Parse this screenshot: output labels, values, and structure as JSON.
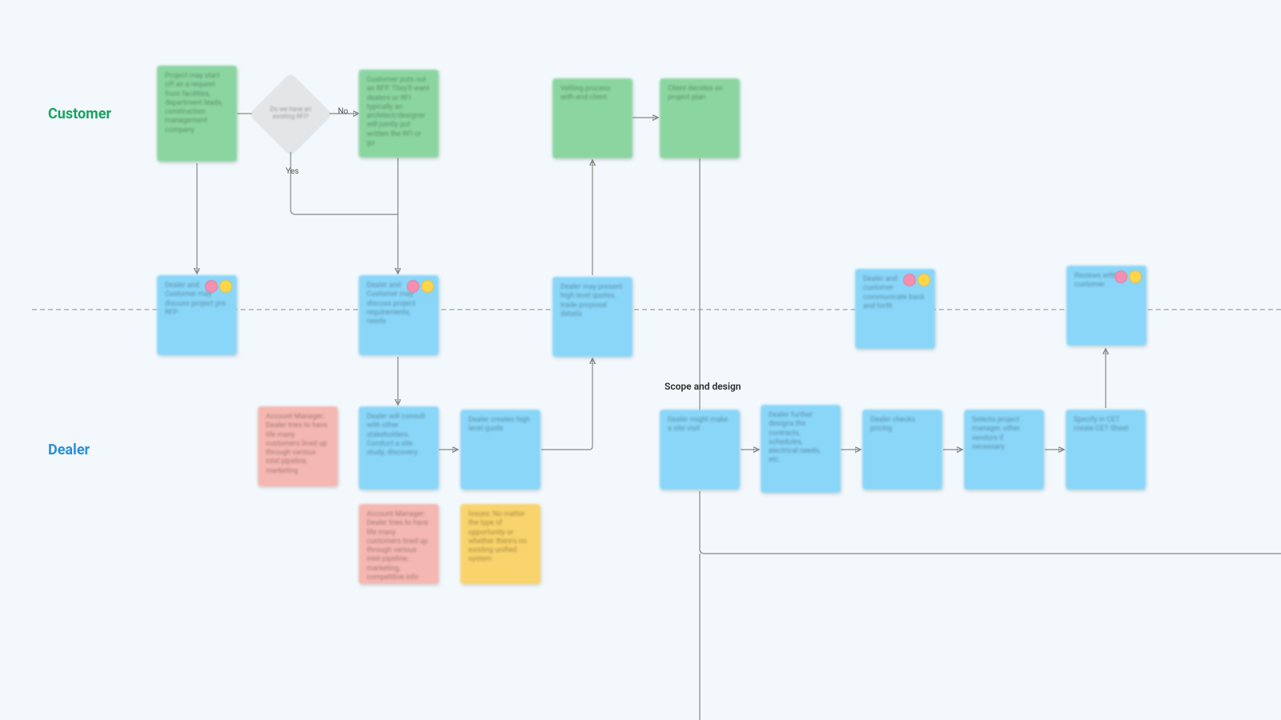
{
  "lanes": {
    "customer": "Customer",
    "dealer": "Dealer"
  },
  "section_scope_design": "Scope and design",
  "decision": {
    "question": "Do we have an existing RFI?",
    "no": "No",
    "yes": "Yes"
  },
  "nodes": {
    "c1": "Project may start off as a request from facilities, department leads, construction management company",
    "c2": "Customer puts out an RFP. They'll want dealers or RFI typically an architect/designer will jointly put written the RFI or go",
    "c3": "Vetting process with end client",
    "c4": "Client decides on project plan",
    "d1": "Dealer and Customer may discuss project pre RFP",
    "d2": "Dealer and Customer may discuss project requirements, needs",
    "d3": "Dealer may present high level quotes, trade proposal details",
    "d4": "Dealer and customer communicate back and forth",
    "d5": "Reviews with customer",
    "p1": "Account Manager: Dealer tries to have life many customers lined up through various intel pipeline, marketing",
    "b1": "Dealer will consult with other stakeholders. Conduct a site study, discovery",
    "b2": "Dealer creates high level quote",
    "p2": "Account Manager: Dealer tries to have life many customers lined up through various intel pipeline, marketing, competitive info",
    "y1": "Issues: No matter the type of opportunity or whether there's no existing unified system",
    "s1": "Dealer might make a site visit",
    "s2": "Dealer further designs the contracts, schedules, electrical needs, etc.",
    "s3": "Dealer checks pricing",
    "s4": "Selects project manager, other vendors if necessary",
    "s5": "Specify in CET create CET Sheet"
  }
}
